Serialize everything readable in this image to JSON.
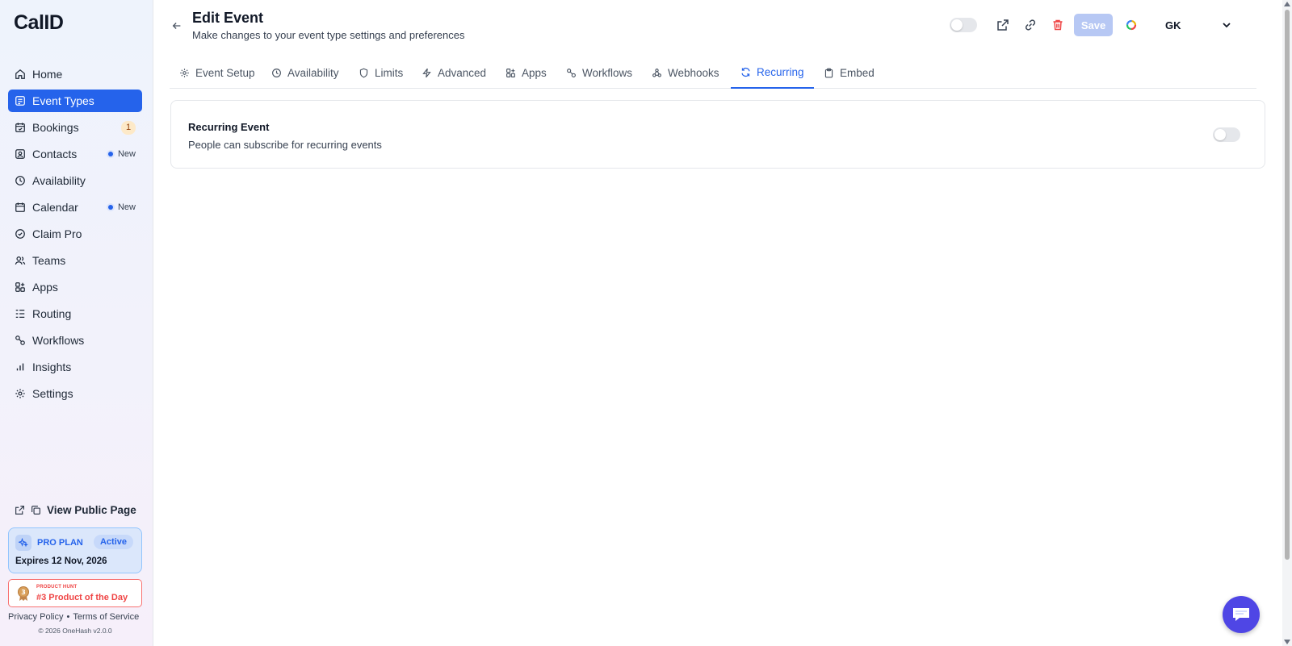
{
  "app": {
    "logo_text": "CalID"
  },
  "sidebar": {
    "items": [
      {
        "label": "Home",
        "icon": "home-icon"
      },
      {
        "label": "Event Types",
        "icon": "event-types-icon",
        "active": true
      },
      {
        "label": "Bookings",
        "icon": "calendar-check-icon",
        "count": "1"
      },
      {
        "label": "Contacts",
        "icon": "contacts-icon",
        "badge": "New"
      },
      {
        "label": "Availability",
        "icon": "clock-icon"
      },
      {
        "label": "Calendar",
        "icon": "calendar-icon",
        "badge": "New"
      },
      {
        "label": "Claim Pro",
        "icon": "claim-pro-icon"
      },
      {
        "label": "Teams",
        "icon": "users-icon"
      },
      {
        "label": "Apps",
        "icon": "apps-icon"
      },
      {
        "label": "Routing",
        "icon": "routing-icon"
      },
      {
        "label": "Workflows",
        "icon": "workflows-icon"
      },
      {
        "label": "Insights",
        "icon": "bar-chart-icon"
      },
      {
        "label": "Settings",
        "icon": "gear-icon"
      }
    ],
    "public_page_label": "View Public Page",
    "pro_plan": {
      "title": "PRO PLAN",
      "status": "Active",
      "expiry": "Expires 12 Nov, 2026"
    },
    "product_hunt": {
      "kicker": "PRODUCT HUNT",
      "title": "#3 Product of the Day"
    },
    "footer": {
      "privacy": "Privacy Policy",
      "separator": "•",
      "terms": "Terms of Service",
      "copyright": "© 2026 OneHash v2.0.0"
    }
  },
  "header": {
    "title": "Edit Event",
    "subtitle": "Make changes to your event type settings and preferences",
    "save_label": "Save",
    "user_initials": "GK"
  },
  "tabs": [
    {
      "label": "Event Setup",
      "icon": "gear-icon"
    },
    {
      "label": "Availability",
      "icon": "clock-icon"
    },
    {
      "label": "Limits",
      "icon": "shield-icon"
    },
    {
      "label": "Advanced",
      "icon": "bolt-icon"
    },
    {
      "label": "Apps",
      "icon": "apps-icon"
    },
    {
      "label": "Workflows",
      "icon": "workflows-icon"
    },
    {
      "label": "Webhooks",
      "icon": "webhook-icon"
    },
    {
      "label": "Recurring",
      "icon": "refresh-icon",
      "active": true
    },
    {
      "label": "Embed",
      "icon": "clipboard-icon"
    }
  ],
  "recurring": {
    "title": "Recurring Event",
    "description": "People can subscribe for recurring events",
    "enabled": false
  },
  "colors": {
    "accent": "#2563eb",
    "danger": "#ef4444",
    "save_disabled": "#b7c8f4",
    "chat": "#4f46e5"
  }
}
